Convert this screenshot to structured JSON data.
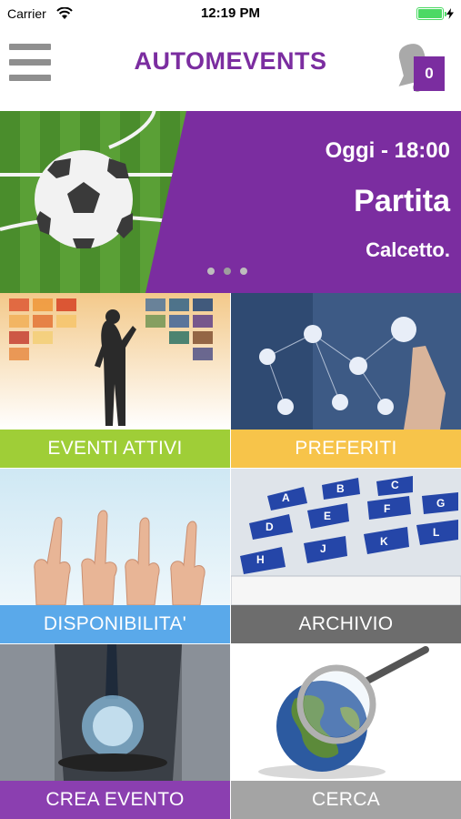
{
  "status_bar": {
    "carrier": "Carrier",
    "time": "12:19 PM",
    "battery_level": 1.0
  },
  "header": {
    "title": "AUTOMEVENTS",
    "menu_icon": "hamburger-menu-icon",
    "bell_icon": "bell-icon",
    "notification_count": "0"
  },
  "banner": {
    "date": "Oggi - 18:00",
    "title": "Partita",
    "subtitle": "Calcetto.",
    "slide_count": 3,
    "active_slide": 1
  },
  "tiles": [
    {
      "label": "EVENTI ATTIVI",
      "color": "#9fce37"
    },
    {
      "label": "PREFERITI",
      "color": "#f7c44a"
    },
    {
      "label": "DISPONIBILITA'",
      "color": "#5aa9ea"
    },
    {
      "label": "ARCHIVIO",
      "color": "#6d6d6d"
    },
    {
      "label": "CREA EVENTO",
      "color": "#8b3fb0"
    },
    {
      "label": "CERCA",
      "color": "#a4a4a4"
    }
  ],
  "colors": {
    "brand": "#7b2da0",
    "field": "#4f9a2e"
  }
}
